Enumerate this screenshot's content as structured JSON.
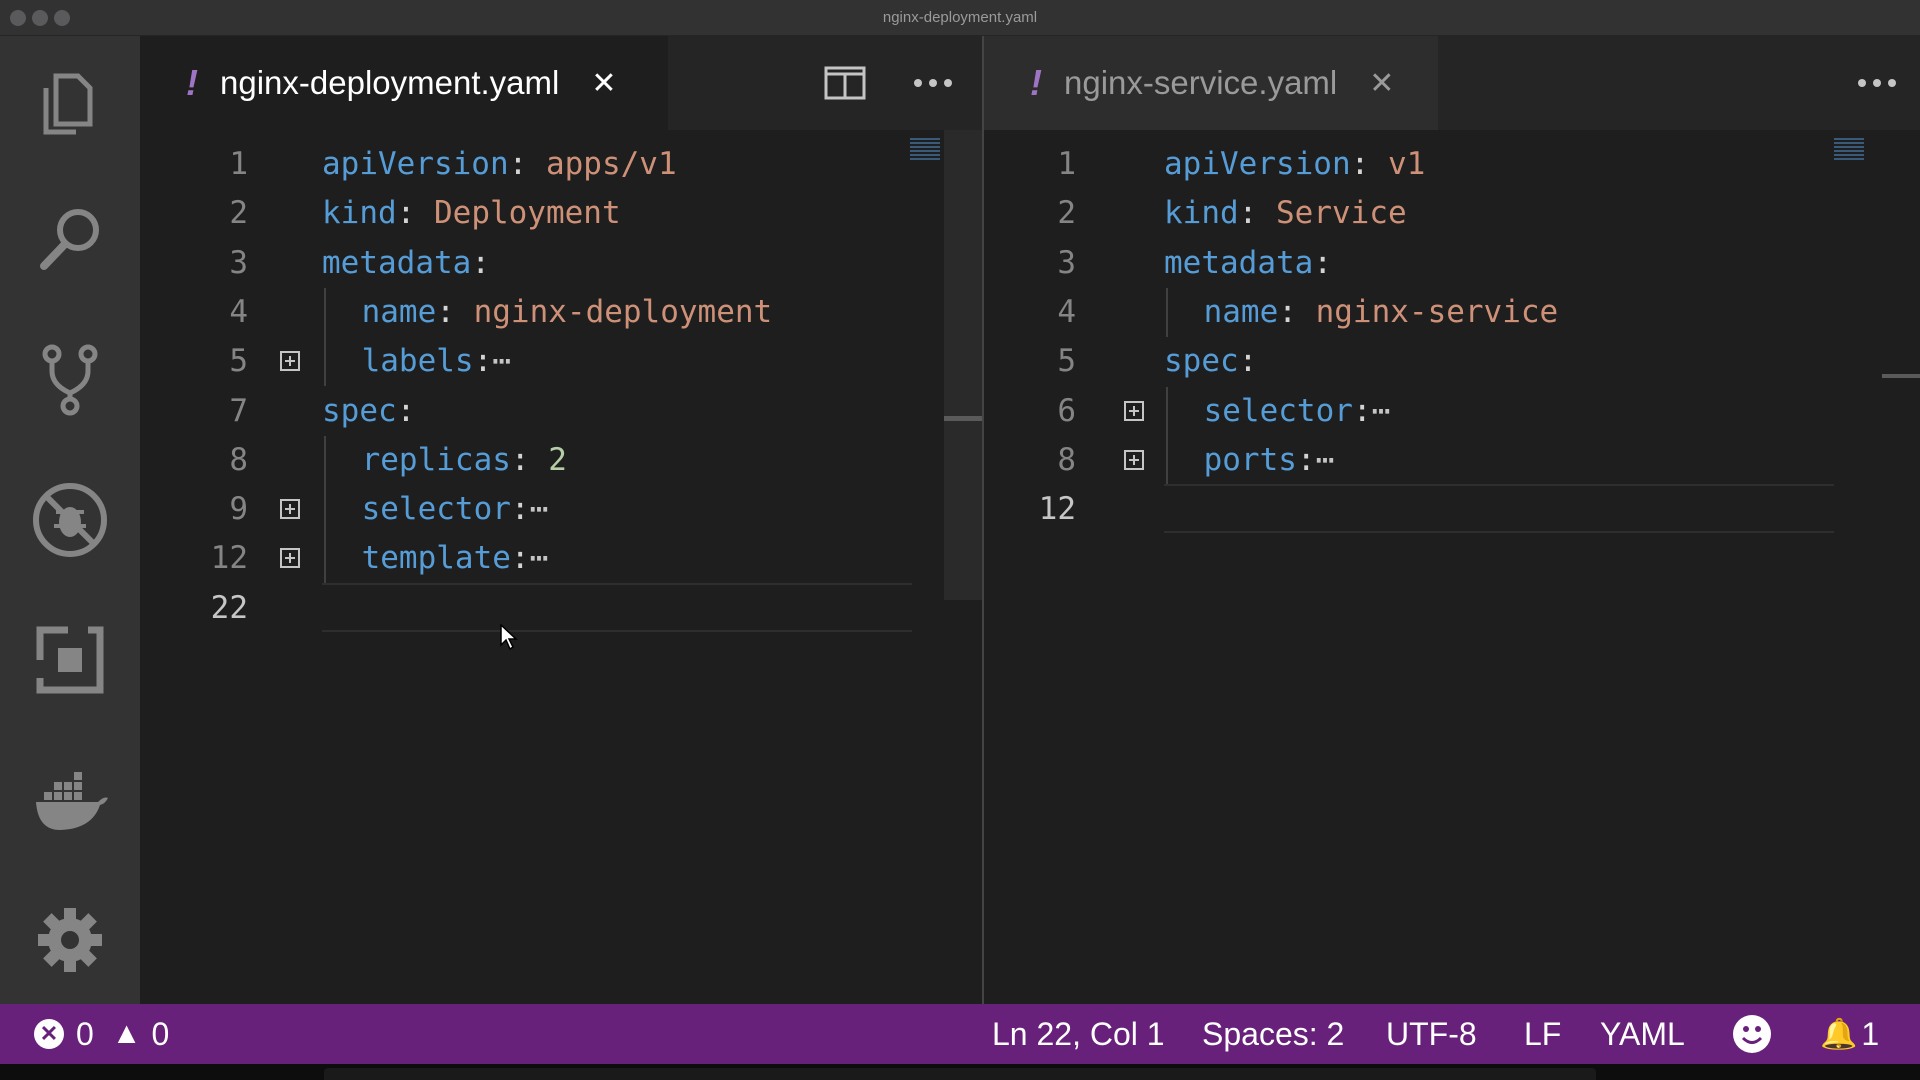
{
  "window": {
    "title": "nginx-deployment.yaml"
  },
  "activity_bar": {
    "icons": [
      "explorer-icon",
      "search-icon",
      "source-control-icon",
      "debug-icon",
      "extensions-icon",
      "docker-icon",
      "gear-icon"
    ]
  },
  "left_group": {
    "tab": {
      "modified_marker": "!",
      "label": "nginx-deployment.yaml",
      "close": "✕"
    },
    "actions": [
      "split-editor-icon",
      "more-actions-icon"
    ],
    "lines": [
      {
        "num": "1",
        "key": "apiVersion",
        "colon": ":",
        "value": " apps/v1"
      },
      {
        "num": "2",
        "key": "kind",
        "colon": ":",
        "value": " Deployment"
      },
      {
        "num": "3",
        "key": "metadata",
        "colon": ":",
        "value": ""
      },
      {
        "num": "4",
        "key": "name",
        "colon": ":",
        "value": " nginx-deployment"
      },
      {
        "num": "5",
        "key": "labels",
        "colon": ":",
        "value": "",
        "folded": "⋯"
      },
      {
        "num": "7",
        "key": "spec",
        "colon": ":",
        "value": ""
      },
      {
        "num": "8",
        "key": "replicas",
        "colon": ":",
        "value": " 2"
      },
      {
        "num": "9",
        "key": "selector",
        "colon": ":",
        "value": "",
        "folded": "⋯"
      },
      {
        "num": "12",
        "key": "template",
        "colon": ":",
        "value": "",
        "folded": "⋯"
      },
      {
        "num": "22",
        "key": "",
        "colon": "",
        "value": ""
      }
    ]
  },
  "right_group": {
    "tab": {
      "modified_marker": "!",
      "label": "nginx-service.yaml",
      "close": "✕"
    },
    "actions": [
      "more-actions-icon"
    ],
    "lines": [
      {
        "num": "1",
        "key": "apiVersion",
        "colon": ":",
        "value": " v1"
      },
      {
        "num": "2",
        "key": "kind",
        "colon": ":",
        "value": " Service"
      },
      {
        "num": "3",
        "key": "metadata",
        "colon": ":",
        "value": ""
      },
      {
        "num": "4",
        "key": "name",
        "colon": ":",
        "value": " nginx-service"
      },
      {
        "num": "5",
        "key": "spec",
        "colon": ":",
        "value": ""
      },
      {
        "num": "6",
        "key": "selector",
        "colon": ":",
        "value": "",
        "folded": "⋯"
      },
      {
        "num": "8",
        "key": "ports",
        "colon": ":",
        "value": "",
        "folded": "⋯"
      },
      {
        "num": "12",
        "key": "",
        "colon": "",
        "value": ""
      }
    ]
  },
  "status_bar": {
    "errors": "0",
    "warnings": "0",
    "cursor": "Ln 22, Col 1",
    "indent": "Spaces: 2",
    "encoding": "UTF-8",
    "eol": "LF",
    "language": "YAML",
    "notifications": "1"
  },
  "colors": {
    "status_bar": "#68217a",
    "key": "#569cd6",
    "string": "#ce9178",
    "number": "#b5cea8",
    "modified_marker": "#a074c4"
  }
}
